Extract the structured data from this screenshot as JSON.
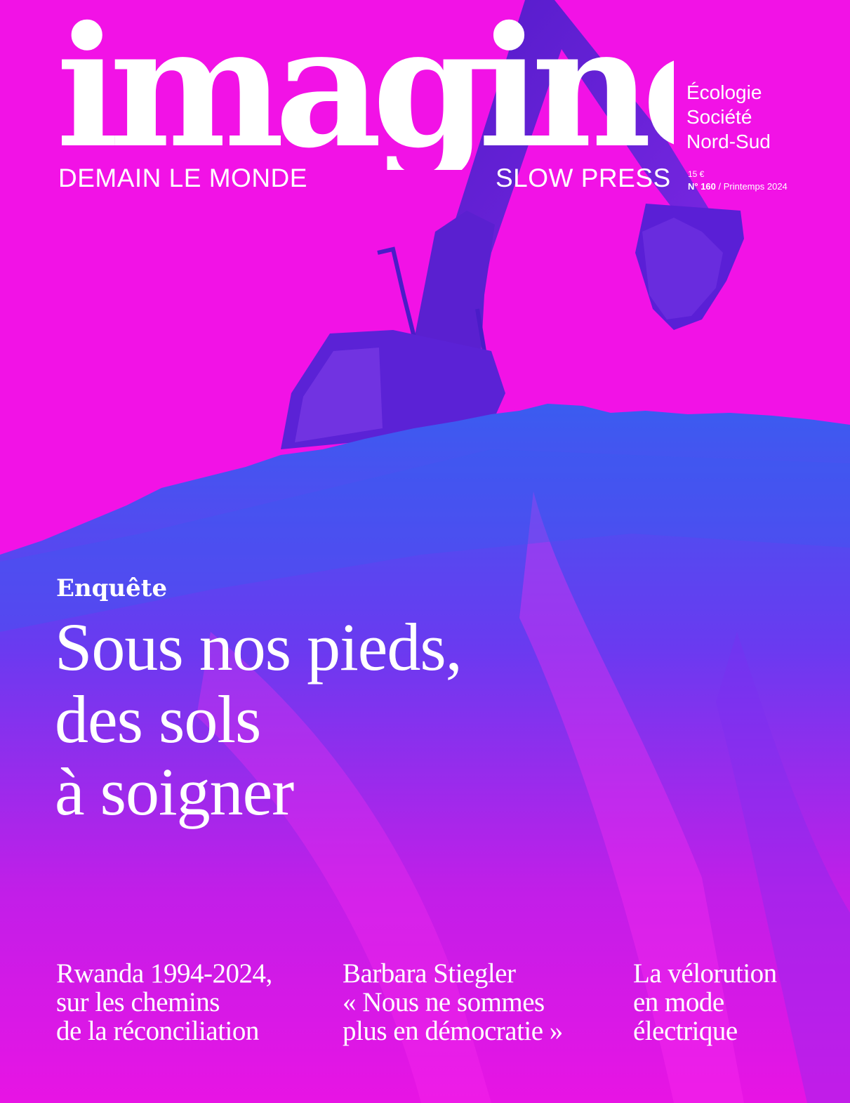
{
  "colors": {
    "background": "#f212e6",
    "ground_blue": "#3a5cf0",
    "ground_violet": "#7a2ff0",
    "machine": "#5a1fd6",
    "text": "#ffffff"
  },
  "masthead": {
    "title": "imagine",
    "tagline_left": "DEMAIN LE MONDE",
    "tagline_right": "SLOW PRESS"
  },
  "topics": [
    "Écologie",
    "Société",
    "Nord-Sud"
  ],
  "issue": {
    "price": "15 €",
    "number": "N° 160",
    "season": " / Printemps 2024"
  },
  "illustration": {
    "subject": "excavator-over-soil-mound"
  },
  "feature": {
    "kicker": "Enquête",
    "headline_lines": [
      "Sous nos pieds,",
      "des sols",
      "à soigner"
    ]
  },
  "teasers": [
    {
      "lines": [
        "Rwanda 1994-2024,",
        "sur les chemins",
        "de la réconciliation"
      ]
    },
    {
      "lines": [
        "Barbara Stiegler",
        "« Nous ne sommes",
        "plus en démocratie »"
      ]
    },
    {
      "lines": [
        "La vélorution",
        "en mode",
        "électrique"
      ]
    }
  ]
}
